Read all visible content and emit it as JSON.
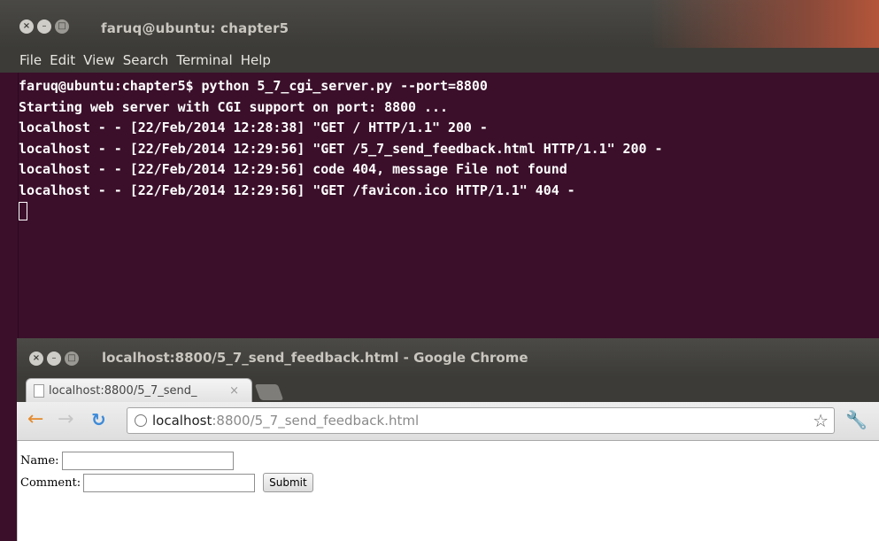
{
  "terminal": {
    "title": "faruq@ubuntu: chapter5",
    "menu": [
      "File",
      "Edit",
      "View",
      "Search",
      "Terminal",
      "Help"
    ],
    "lines": [
      "faruq@ubuntu:chapter5$ python 5_7_cgi_server.py --port=8800",
      "Starting web server with CGI support on port: 8800 ...",
      "localhost - - [22/Feb/2014 12:28:38] \"GET / HTTP/1.1\" 200 -",
      "localhost - - [22/Feb/2014 12:29:56] \"GET /5_7_send_feedback.html HTTP/1.1\" 200 -",
      "localhost - - [22/Feb/2014 12:29:56] code 404, message File not found",
      "localhost - - [22/Feb/2014 12:29:56] \"GET /favicon.ico HTTP/1.1\" 404 -"
    ]
  },
  "chrome": {
    "title": "localhost:8800/5_7_send_feedback.html - Google Chrome",
    "tab_label": "localhost:8800/5_7_send_",
    "tab_close": "×",
    "url_host": "localhost",
    "url_path": ":8800/5_7_send_feedback.html",
    "icons": {
      "back": "back-arrow-icon",
      "forward": "forward-arrow-icon",
      "reload": "reload-icon",
      "page": "globe-icon",
      "bookmark": "star-icon",
      "menu": "wrench-icon"
    }
  },
  "form": {
    "name_label": "Name:",
    "comment_label": "Comment:",
    "submit_label": "Submit"
  },
  "colors": {
    "terminal_bg": "#3b0f2a",
    "titlebar": "#3c3b37",
    "accent_orange": "#e58a2c"
  }
}
